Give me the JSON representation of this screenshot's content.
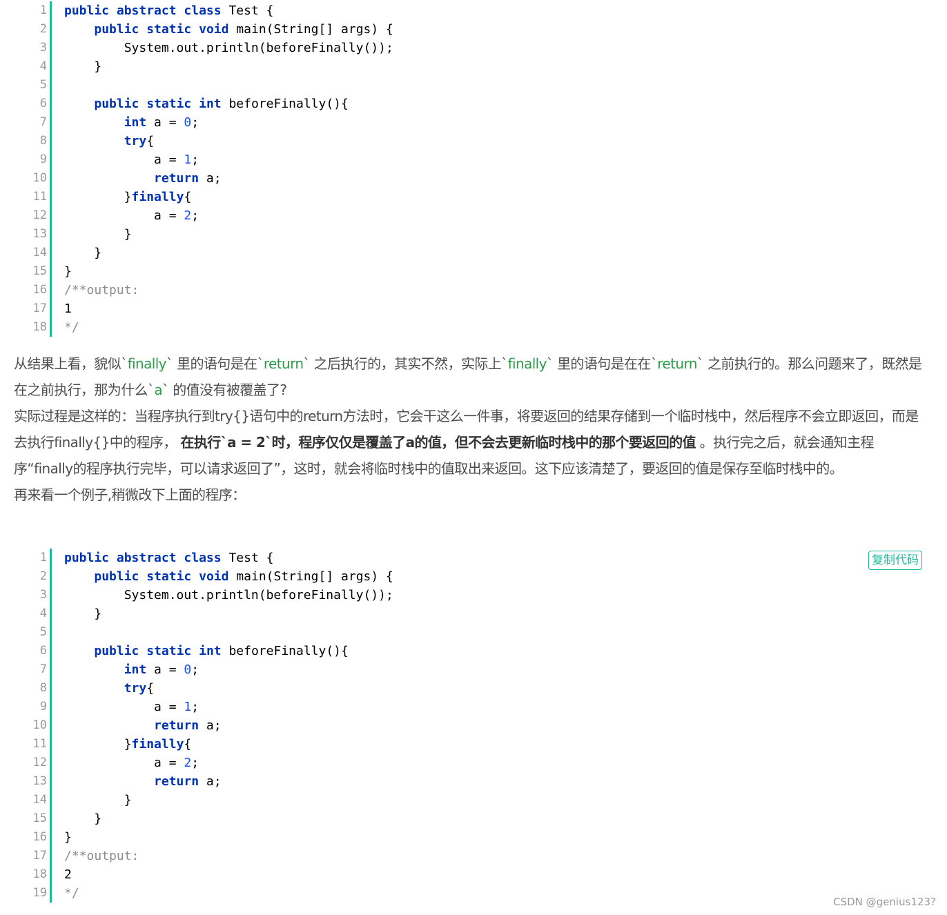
{
  "code1": {
    "line_numbers": [
      "1",
      "2",
      "3",
      "4",
      "5",
      "6",
      "7",
      "8",
      "9",
      "10",
      "11",
      "12",
      "13",
      "14",
      "15",
      "16",
      "17",
      "18"
    ],
    "lines": [
      "public abstract class Test {",
      "    public static void main(String[] args) {",
      "        System.out.println(beforeFinally());",
      "    }",
      "",
      "    public static int beforeFinally(){",
      "        int a = 0;",
      "        try{",
      "            a = 1;",
      "            return a;",
      "        }finally{",
      "            a = 2;",
      "        }",
      "    }",
      "}",
      "/**output:",
      "1",
      "*/"
    ]
  },
  "prose": {
    "p1_a": "从结果上看，貌似`",
    "p1_c1": "finally",
    "p1_b": "` 里的语句是在`",
    "p1_c2": "return",
    "p1_c": "` 之后执行的，其实不然，实际上`",
    "p1_c3": "finally",
    "p1_d": "` 里的语句是在在`",
    "p1_c4": "return",
    "p1_e": "` 之前执行的。那么问题来了，既然是在之前执行，那为什么`",
    "p1_c5": "a",
    "p1_f": "` 的值没有被覆盖了?",
    "p2_a": "实际过程是这样的：当程序执行到try{}语句中的return方法时，它会干这么一件事，将要返回的结果存储到一个临时栈中，然后程序不会立即返回，而是去执行finally{}中的程序，",
    "p2_bold": "在执行`a = 2`时，程序仅仅是覆盖了a的值，但不会去更新临时栈中的那个要返回的值",
    "p2_b": "。执行完之后，就会通知主程序“finally的程序执行完毕，可以请求返回了”，这时，就会将临时栈中的值取出来返回。这下应该清楚了，要返回的值是保存至临时栈中的。",
    "p3": "再来看一个例子,稍微改下上面的程序："
  },
  "code2": {
    "copy_label": "复制代码",
    "line_numbers": [
      "1",
      "2",
      "3",
      "4",
      "5",
      "6",
      "7",
      "8",
      "9",
      "10",
      "11",
      "12",
      "13",
      "14",
      "15",
      "16",
      "17",
      "18",
      "19"
    ],
    "lines": [
      "public abstract class Test {",
      "    public static void main(String[] args) {",
      "        System.out.println(beforeFinally());",
      "    }",
      "",
      "    public static int beforeFinally(){",
      "        int a = 0;",
      "        try{",
      "            a = 1;",
      "            return a;",
      "        }finally{",
      "            a = 2;",
      "            return a;",
      "        }",
      "    }",
      "}",
      "/**output:",
      "2",
      "*/"
    ]
  },
  "watermark": "CSDN @genius123?"
}
